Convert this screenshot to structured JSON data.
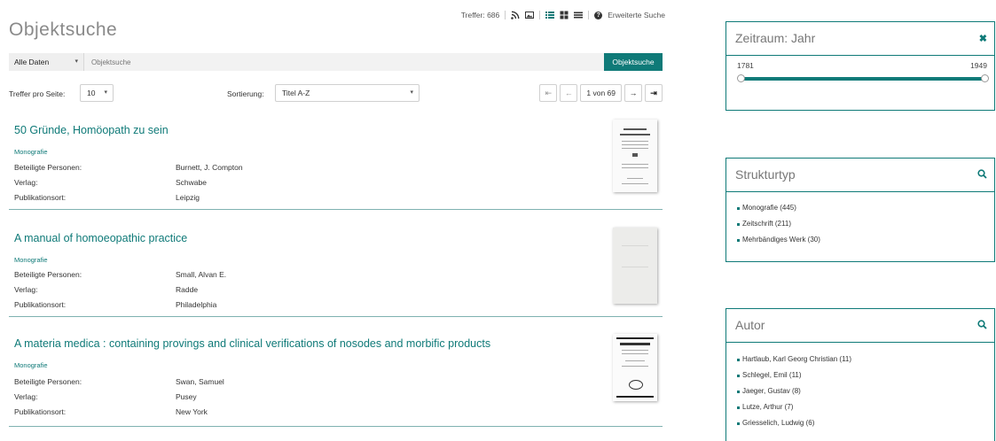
{
  "page": {
    "title": "Objektsuche"
  },
  "topbar": {
    "hits": "Treffer: 686",
    "advanced_search": "Erweiterte Suche"
  },
  "search": {
    "scope": "Alle Daten",
    "placeholder": "Objektsuche",
    "button": "Objektsuche"
  },
  "options": {
    "per_page_label": "Treffer pro Seite:",
    "per_page_value": "10",
    "sort_label": "Sortierung:",
    "sort_value": "Titel A-Z",
    "pager_info": "1 von 69"
  },
  "results": [
    {
      "title": "50 Gründe, Homöopath zu sein",
      "type": "Monografie",
      "fields": [
        {
          "label": "Beteiligte Personen:",
          "value": "Burnett, J. Compton"
        },
        {
          "label": "Verlag:",
          "value": "Schwabe"
        },
        {
          "label": "Publikationsort:",
          "value": "Leipzig"
        }
      ]
    },
    {
      "title": "A manual of homoeopathic practice",
      "type": "Monografie",
      "fields": [
        {
          "label": "Beteiligte Personen:",
          "value": "Small, Alvan E."
        },
        {
          "label": "Verlag:",
          "value": "Radde"
        },
        {
          "label": "Publikationsort:",
          "value": "Philadelphia"
        }
      ]
    },
    {
      "title": "A materia medica : containing provings and clinical verifications of nosodes and morbific products",
      "type": "Monografie",
      "fields": [
        {
          "label": "Beteiligte Personen:",
          "value": "Swan, Samuel"
        },
        {
          "label": "Verlag:",
          "value": "Pusey"
        },
        {
          "label": "Publikationsort:",
          "value": "New York"
        }
      ]
    }
  ],
  "sidebar": {
    "zeitraum": {
      "title": "Zeitraum: Jahr",
      "min": "1781",
      "max": "1949"
    },
    "strukturtyp": {
      "title": "Strukturtyp",
      "items": [
        "Monografie (445)",
        "Zeitschrift (211)",
        "Mehrbändiges Werk (30)"
      ]
    },
    "autor": {
      "title": "Autor",
      "items": [
        "Hartlaub, Karl Georg Christian (11)",
        "Schlegel, Emil (11)",
        "Jaeger, Gustav (8)",
        "Lutze, Arthur (7)",
        "Griesselich, Ludwig (6)"
      ]
    }
  },
  "colors": {
    "accent": "#0f7a78"
  }
}
